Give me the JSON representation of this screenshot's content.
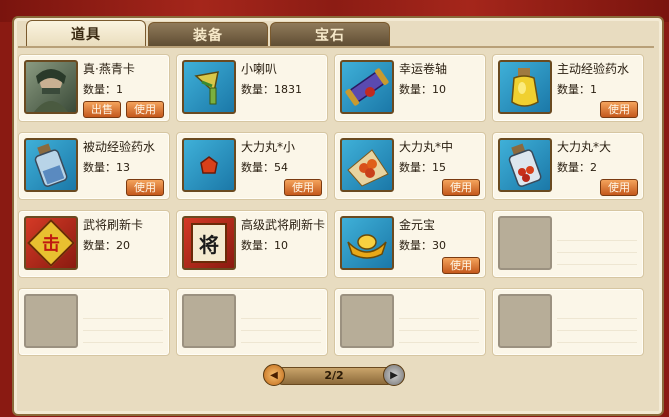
{
  "tabs": [
    {
      "label": "道具",
      "active": true
    },
    {
      "label": "装备",
      "active": false
    },
    {
      "label": "宝石",
      "active": false
    }
  ],
  "items": [
    {
      "name": "真·燕青卡",
      "qty": "数量：1",
      "icon": "hero-portrait-icon",
      "buttons": [
        "出售",
        "使用"
      ]
    },
    {
      "name": "小喇叭",
      "qty": "数量：1831",
      "icon": "horn-icon",
      "buttons": []
    },
    {
      "name": "幸运卷轴",
      "qty": "数量：10",
      "icon": "scroll-icon",
      "buttons": []
    },
    {
      "name": "主动经验药水",
      "qty": "数量：1",
      "icon": "yellow-potion-icon",
      "buttons": [
        "使用"
      ]
    },
    {
      "name": "被动经验药水",
      "qty": "数量：13",
      "icon": "blue-potion-icon",
      "buttons": [
        "使用"
      ]
    },
    {
      "name": "大力丸*小",
      "qty": "数量：54",
      "icon": "small-pill-icon",
      "buttons": [
        "使用"
      ]
    },
    {
      "name": "大力丸*中",
      "qty": "数量：15",
      "icon": "medium-pill-icon",
      "buttons": [
        "使用"
      ]
    },
    {
      "name": "大力丸*大",
      "qty": "数量：2",
      "icon": "large-pill-jar-icon",
      "buttons": [
        "使用"
      ]
    },
    {
      "name": "武将刷新卡",
      "qty": "数量：20",
      "icon": "refresh-card-icon",
      "buttons": []
    },
    {
      "name": "高级武将刷新卡",
      "qty": "数量：10",
      "icon": "advanced-refresh-card-icon",
      "buttons": []
    },
    {
      "name": "金元宝",
      "qty": "数量：30",
      "icon": "gold-ingot-icon",
      "buttons": [
        "使用"
      ]
    }
  ],
  "card_glyphs": {
    "refresh": "击",
    "advanced": "将"
  },
  "pager": {
    "text": "2/2"
  },
  "colors": {
    "button": "#d8742c",
    "icon_bg": "#2a94c4",
    "panel": "#e8dcc0"
  }
}
